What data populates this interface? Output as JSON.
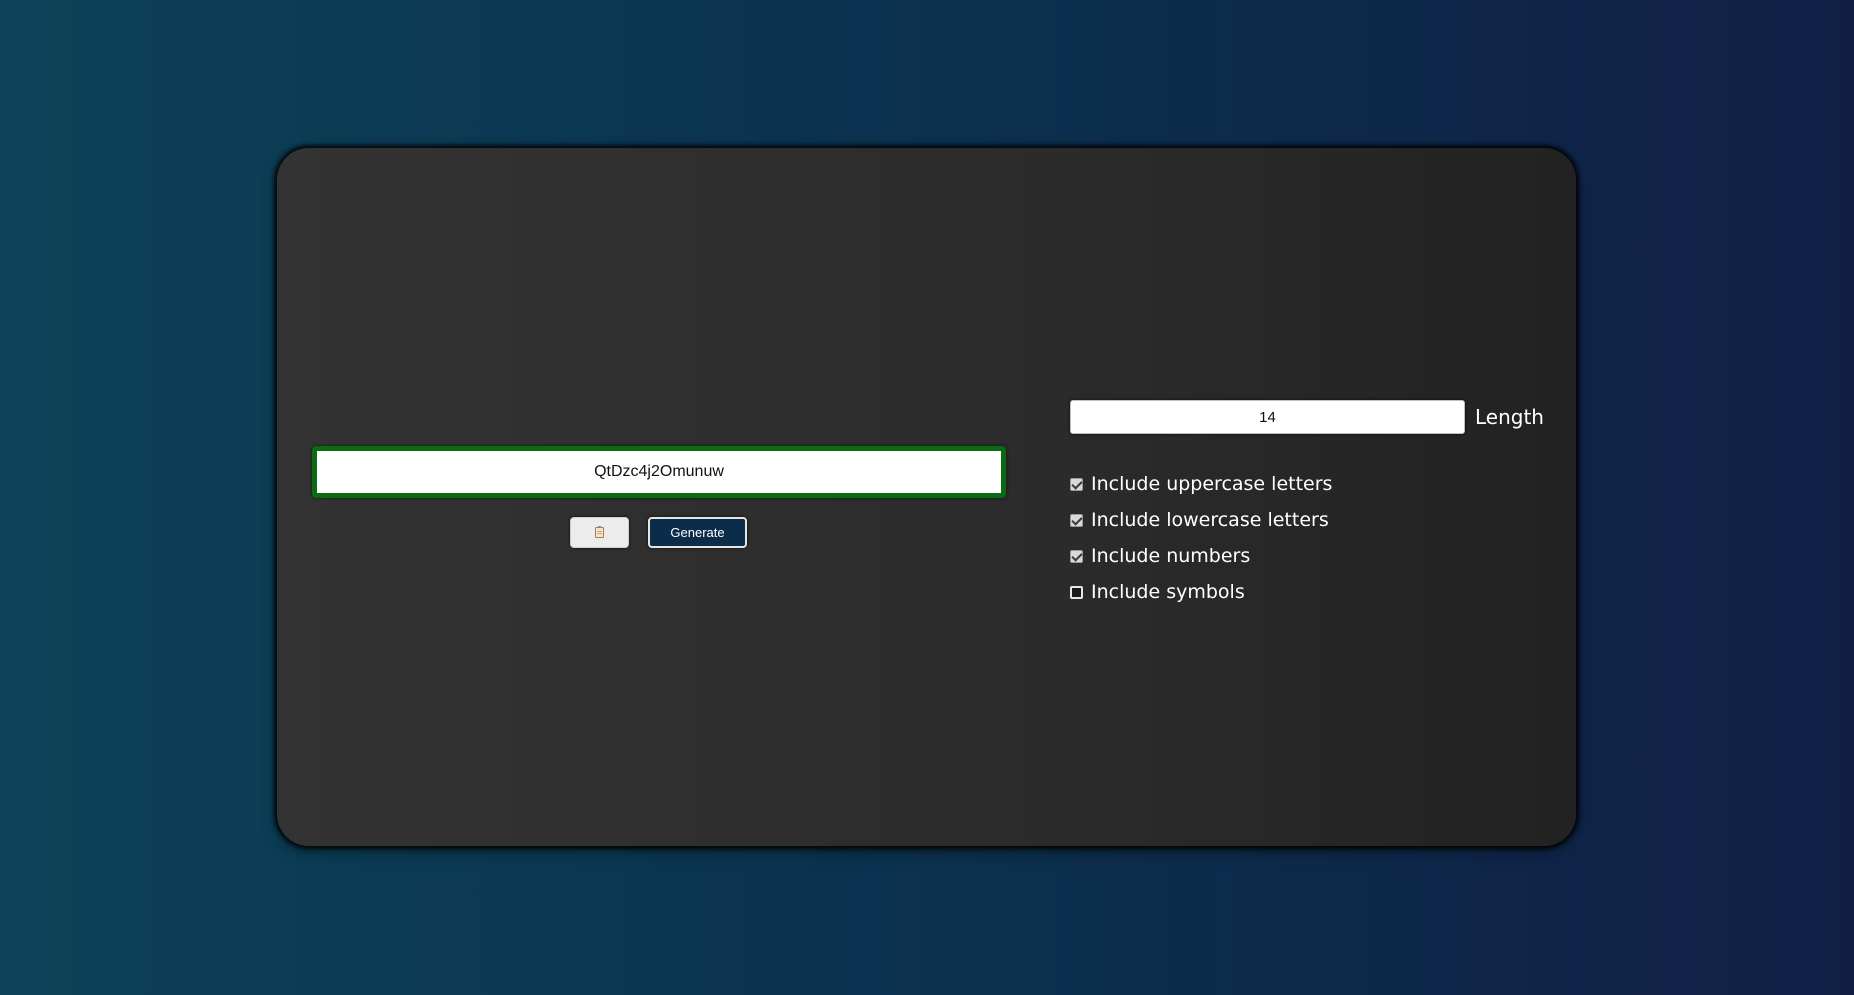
{
  "generator": {
    "password": "QtDzc4j2Omunuw",
    "copy_icon": "clipboard-icon",
    "generate_label": "Generate"
  },
  "settings": {
    "length_value": "14",
    "length_label": "Length",
    "options": [
      {
        "label": "Include uppercase letters",
        "checked": true
      },
      {
        "label": "Include lowercase letters",
        "checked": true
      },
      {
        "label": "Include numbers",
        "checked": true
      },
      {
        "label": "Include symbols",
        "checked": false
      }
    ]
  },
  "colors": {
    "password_border": "#0b6b12",
    "generate_button": "#0c2d4a",
    "card_background": "#2e2e2e"
  }
}
